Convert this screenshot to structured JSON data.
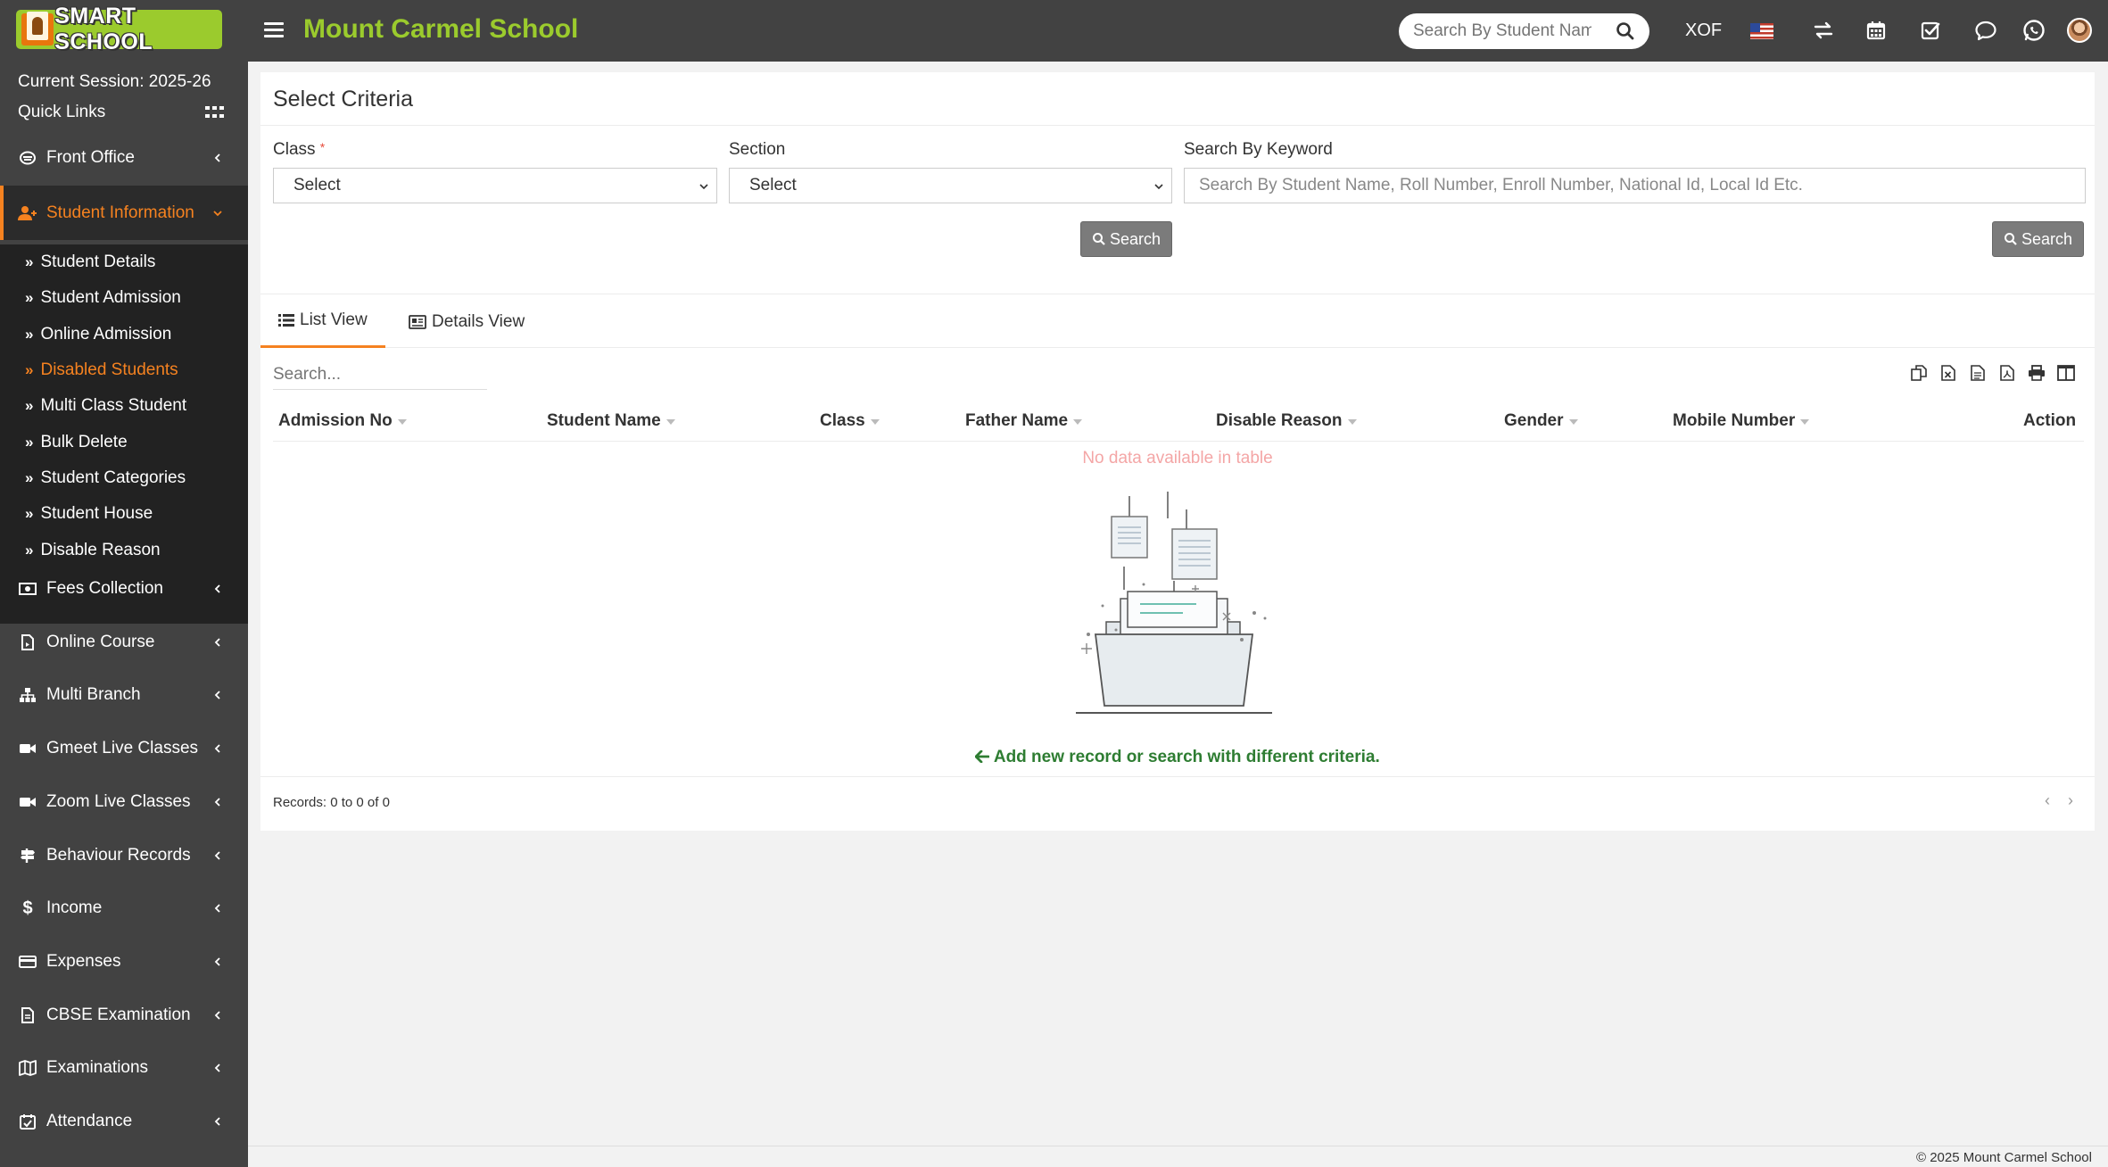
{
  "brand": {
    "logo_text": "SMART SCHOOL",
    "school_name": "Mount Carmel School",
    "accent_color": "#9bcb2d",
    "active_color": "#f58220"
  },
  "topbar": {
    "search_placeholder": "Search By Student Name",
    "currency": "XOF",
    "icons": [
      "menu-icon",
      "search-icon",
      "flag-us-icon",
      "swap-icon",
      "calendar-icon",
      "task-check-icon",
      "chat-icon",
      "whatsapp-icon",
      "avatar"
    ]
  },
  "sidebar": {
    "session": "Current Session: 2025-26",
    "quick_links": "Quick Links",
    "items": [
      {
        "label": "Front Office",
        "icon": "front-office-icon"
      },
      {
        "label": "Student Information",
        "icon": "student-info-icon",
        "active": true
      },
      {
        "label": "Fees Collection",
        "icon": "money-icon"
      },
      {
        "label": "Online Course",
        "icon": "course-icon"
      },
      {
        "label": "Multi Branch",
        "icon": "sitemap-icon"
      },
      {
        "label": "Gmeet Live Classes",
        "icon": "video-icon"
      },
      {
        "label": "Zoom Live Classes",
        "icon": "video-icon"
      },
      {
        "label": "Behaviour Records",
        "icon": "signpost-icon"
      },
      {
        "label": "Income",
        "icon": "dollar-icon"
      },
      {
        "label": "Expenses",
        "icon": "credit-card-icon"
      },
      {
        "label": "CBSE Examination",
        "icon": "document-icon"
      },
      {
        "label": "Examinations",
        "icon": "map-icon"
      },
      {
        "label": "Attendance",
        "icon": "calendar-check-icon"
      }
    ],
    "submenu": [
      {
        "label": "Student Details"
      },
      {
        "label": "Student Admission"
      },
      {
        "label": "Online Admission"
      },
      {
        "label": "Disabled Students",
        "active": true
      },
      {
        "label": "Multi Class Student"
      },
      {
        "label": "Bulk Delete"
      },
      {
        "label": "Student Categories"
      },
      {
        "label": "Student House"
      },
      {
        "label": "Disable Reason"
      }
    ]
  },
  "criteria": {
    "title": "Select Criteria",
    "class_label": "Class",
    "required_mark": "*",
    "class_value": "Select",
    "section_label": "Section",
    "section_value": "Select",
    "keyword_label": "Search By Keyword",
    "keyword_placeholder": "Search By Student Name, Roll Number, Enroll Number, National Id, Local Id Etc.",
    "search_button": "Search",
    "search_button_2": "Search"
  },
  "tabs": {
    "list_view": "List View",
    "details_view": "Details View"
  },
  "table": {
    "search_placeholder": "Search...",
    "tools": [
      "copy-icon",
      "excel-icon",
      "csv-icon",
      "pdf-icon",
      "print-icon",
      "columns-icon"
    ],
    "columns": [
      "Admission No",
      "Student Name",
      "Class",
      "Father Name",
      "Disable Reason",
      "Gender",
      "Mobile Number",
      "Action"
    ],
    "empty_message": "No data available in table",
    "add_message": "Add new record or search with different criteria.",
    "records": "Records: 0 to 0 of 0",
    "prev": "‹",
    "next": "›"
  },
  "footer": {
    "copyright": "© 2025 Mount Carmel School"
  }
}
